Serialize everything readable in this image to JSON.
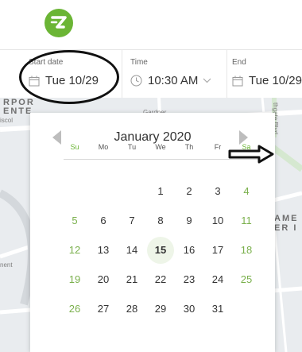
{
  "brand": {
    "logo_letter": "Z",
    "color": "#6bb535"
  },
  "fields": [
    {
      "label": "Start date",
      "value": "Tue 10/29",
      "icon": "calendar-icon"
    },
    {
      "label": "Time",
      "value": "10:30 AM",
      "icon": "clock-icon",
      "dropdown": true
    },
    {
      "label": "End",
      "value": "Tue 10/29",
      "icon": "calendar-icon"
    }
  ],
  "map": {
    "labels": [
      "RPOR",
      "ENTE",
      "AME",
      "ER I"
    ],
    "small_labels": [
      "iscol",
      "Gardner",
      "nent",
      "thgate Blvd"
    ]
  },
  "calendar": {
    "month_title": "January 2020",
    "weekdays": [
      "Su",
      "Mo",
      "Tu",
      "We",
      "Th",
      "Fr",
      "Sa"
    ],
    "weeks": [
      [
        "",
        "",
        "",
        "1",
        "2",
        "3",
        "4"
      ],
      [
        "5",
        "6",
        "7",
        "8",
        "9",
        "10",
        "11"
      ],
      [
        "12",
        "13",
        "14",
        "15",
        "16",
        "17",
        "18"
      ],
      [
        "19",
        "20",
        "21",
        "22",
        "23",
        "24",
        "25"
      ],
      [
        "26",
        "27",
        "28",
        "29",
        "30",
        "31",
        ""
      ]
    ],
    "highlighted_day": "15",
    "weekend_color": "#7ab04c"
  }
}
